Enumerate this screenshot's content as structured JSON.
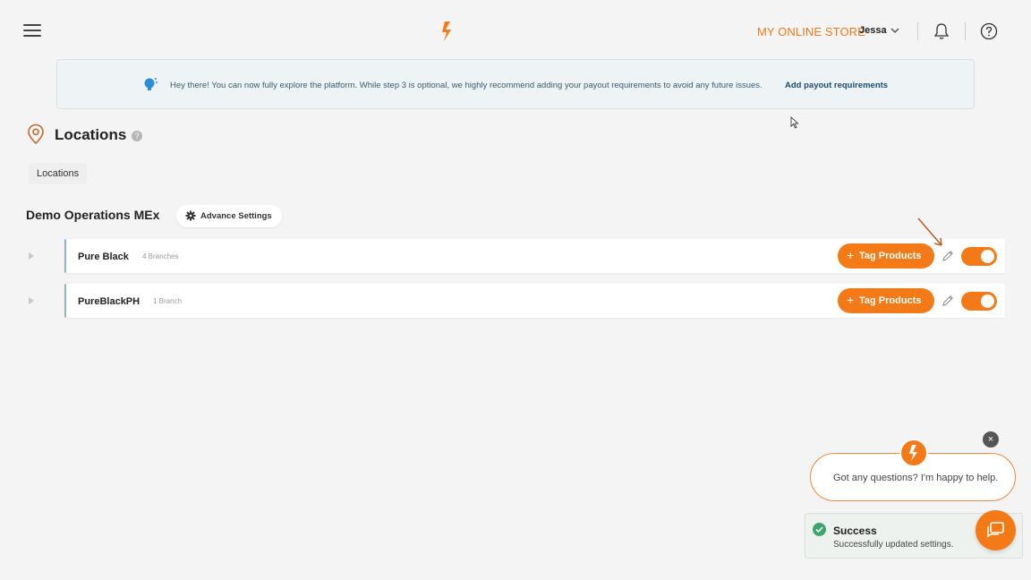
{
  "header": {
    "store_name": "MY ONLINE STORE",
    "user_name": "Jessa"
  },
  "banner": {
    "message": "Hey there! You can now fully explore the platform. While step 3 is optional, we highly recommend adding your payout requirements to avoid any future issues.",
    "link": "Add payout requirements"
  },
  "page": {
    "title": "Locations",
    "tab": "Locations"
  },
  "section": {
    "title": "Demo Operations MEx",
    "advance_settings": "Advance Settings"
  },
  "rows": [
    {
      "name": "Pure Black",
      "count": "4 Branches",
      "tag_label": "Tag Products",
      "enabled": true
    },
    {
      "name": "PureBlackPH",
      "count": "1 Branch",
      "tag_label": "Tag Products",
      "enabled": true
    }
  ],
  "chat": {
    "prompt": "Got any questions? I'm happy to help.",
    "close": "×"
  },
  "toast": {
    "title": "Success",
    "message": "Successfully updated settings."
  },
  "colors": {
    "accent": "#f47a18",
    "success": "#3aa66b",
    "banner_bg": "#eef4f6"
  }
}
